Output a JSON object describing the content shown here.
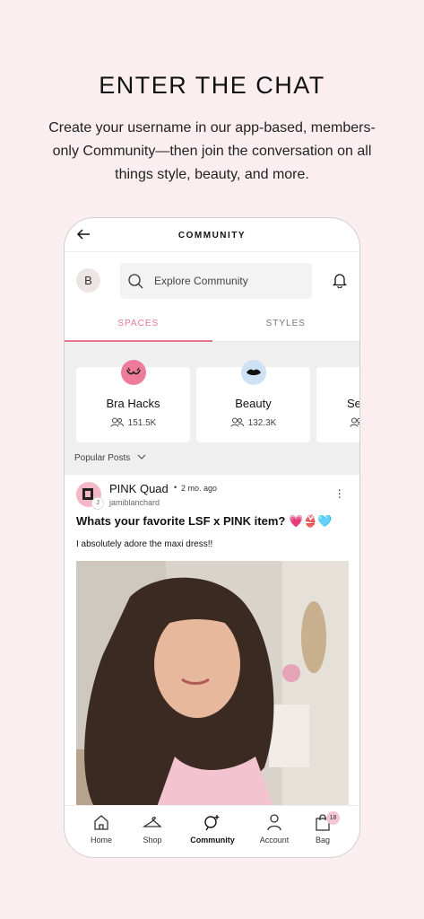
{
  "headline": "ENTER THE CHAT",
  "subtitle": "Create your username in our app-based, members-only Community—then join the conversation on all things style, beauty, and more.",
  "app": {
    "title": "COMMUNITY",
    "avatar_letter": "B",
    "search_placeholder": "Explore Community",
    "tabs": [
      {
        "label": "SPACES",
        "active": true
      },
      {
        "label": "STYLES",
        "active": false
      }
    ],
    "spaces": [
      {
        "name": "Bra Hacks",
        "count": "151.5K",
        "icon": "bra-icon"
      },
      {
        "name": "Beauty",
        "count": "132.3K",
        "icon": "lips-icon"
      },
      {
        "name": "Se",
        "count": "",
        "icon": ""
      }
    ],
    "popular_label": "Popular Posts",
    "post": {
      "group": "PINK Quad",
      "dot": "•",
      "time": "2 mo. ago",
      "username": "jamiblanchard",
      "badge_letter": "J",
      "title": "Whats your favorite LSF x PINK item?",
      "title_emoji": "💗👙🩵",
      "body": "I absolutely adore the maxi dress!!"
    },
    "nav": [
      {
        "label": "Home",
        "icon": "home-icon"
      },
      {
        "label": "Shop",
        "icon": "hanger-icon"
      },
      {
        "label": "Community",
        "icon": "community-icon"
      },
      {
        "label": "Account",
        "icon": "person-icon"
      },
      {
        "label": "Bag",
        "icon": "bag-icon",
        "badge": "18"
      }
    ],
    "colors": {
      "accent": "#e2778f",
      "background": "#fbeef0"
    }
  }
}
